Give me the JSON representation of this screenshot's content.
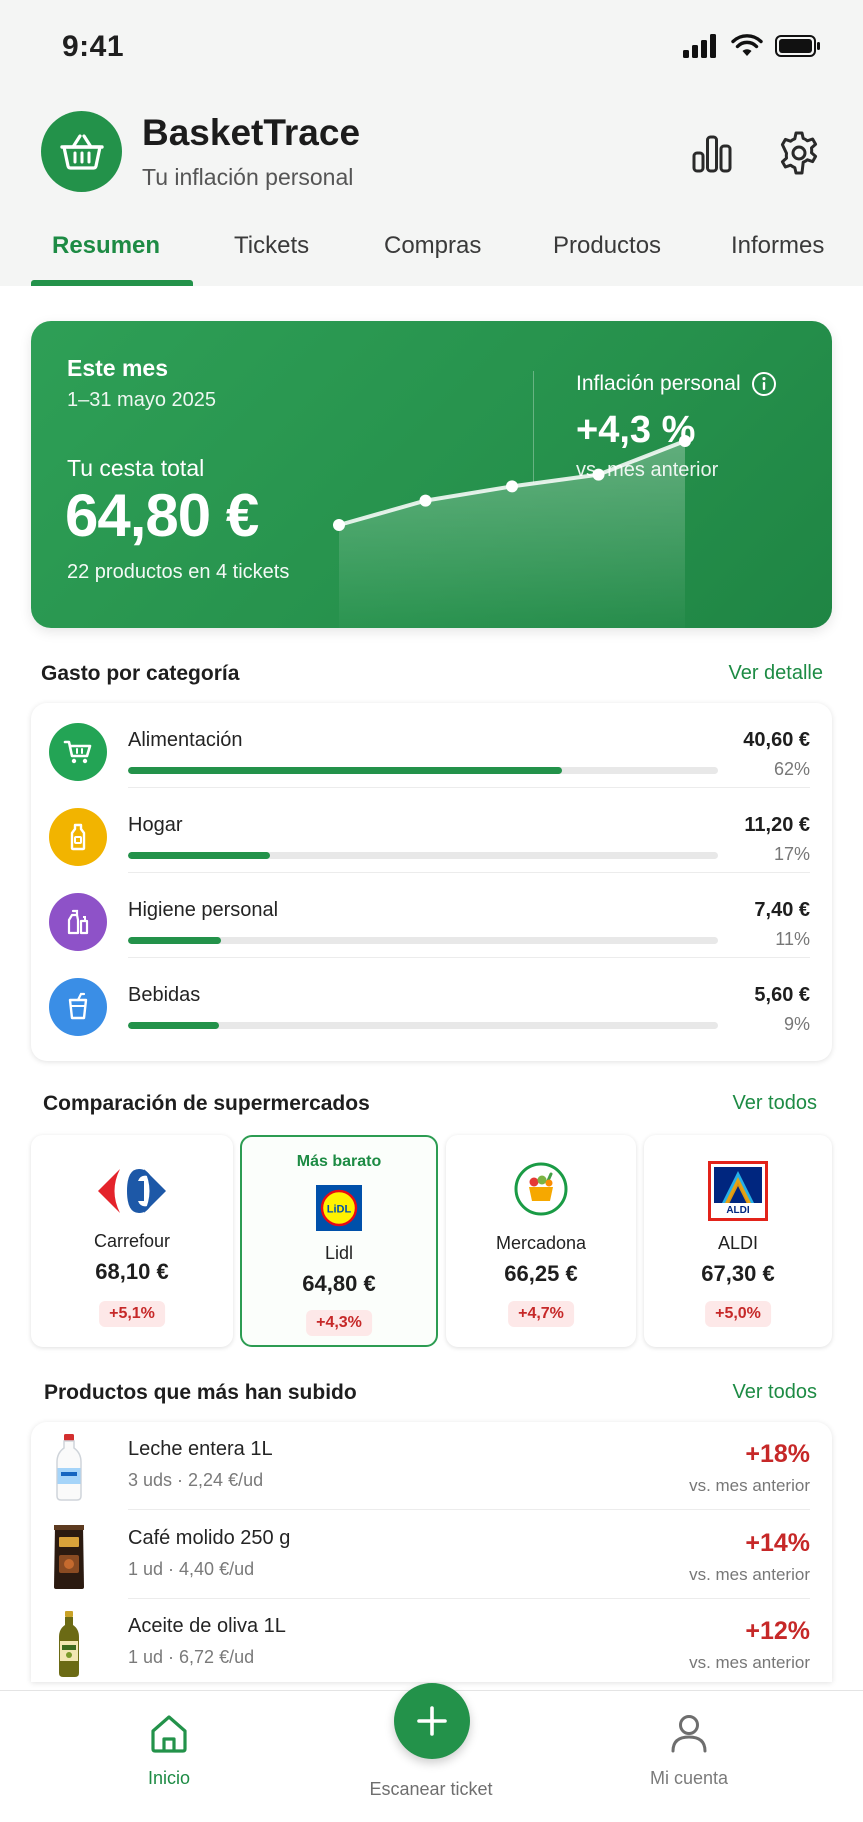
{
  "status": {
    "time": "9:41"
  },
  "app": {
    "title": "BasketTrace",
    "subtitle": "Tu inflación personal"
  },
  "tabs": [
    {
      "label": "Resumen",
      "active": true
    },
    {
      "label": "Tickets"
    },
    {
      "label": "Compras"
    },
    {
      "label": "Productos"
    },
    {
      "label": "Informes"
    }
  ],
  "hero": {
    "period_label": "Este mes",
    "period_range": "1–31 mayo 2025",
    "total_label": "Tu cesta total",
    "total": "64,80 €",
    "count": "22 productos en 4 tickets",
    "inflation_label": "Inflación personal",
    "inflation": "+4,3 %",
    "inflation_vs": "vs. mes anterior",
    "trend": [
      0,
      0.29,
      0.46,
      0.6,
      1
    ]
  },
  "categories": {
    "title": "Gasto por categoría",
    "link": "Ver detalle",
    "items": [
      {
        "name": "Alimentación",
        "amount": "40,60 €",
        "pct": "62%",
        "share": 0.735,
        "color": "#23a455",
        "icon": "cart-icon"
      },
      {
        "name": "Hogar",
        "amount": "11,20 €",
        "pct": "17%",
        "share": 0.24,
        "color": "#f2b400",
        "icon": "bottle-icon"
      },
      {
        "name": "Higiene personal",
        "amount": "7,40 €",
        "pct": "11%",
        "share": 0.158,
        "color": "#8e52c8",
        "icon": "hygiene-icon"
      },
      {
        "name": "Bebidas",
        "amount": "5,60 €",
        "pct": "9%",
        "share": 0.155,
        "color": "#3a8ee6",
        "icon": "cup-icon"
      }
    ]
  },
  "stores": {
    "title": "Comparación de supermercados",
    "link": "Ver todos",
    "best_label": "Más barato",
    "items": [
      {
        "name": "Carrefour",
        "price": "68,10 €",
        "change": "+5,1%"
      },
      {
        "name": "Lidl",
        "price": "64,80 €",
        "change": "+4,3%",
        "best": true
      },
      {
        "name": "Mercadona",
        "price": "66,25 €",
        "change": "+4,7%"
      },
      {
        "name": "ALDI",
        "price": "67,30 €",
        "change": "+5,0%"
      }
    ]
  },
  "products": {
    "title": "Productos que más han subido",
    "link": "Ver todos",
    "items": [
      {
        "name": "Leche entera 1L",
        "meta": "3 uds · 2,24 €/ud",
        "change": "+18%",
        "vs": "vs. mes anterior"
      },
      {
        "name": "Café molido 250 g",
        "meta": "1 ud · 4,40 €/ud",
        "change": "+14%",
        "vs": "vs. mes anterior"
      },
      {
        "name": "Aceite de oliva 1L",
        "meta": "1 ud · 6,72 €/ud",
        "change": "+12%",
        "vs": "vs. mes anterior"
      }
    ]
  },
  "nav": {
    "home": "Inicio",
    "scan": "Escanear ticket",
    "account": "Mi cuenta"
  },
  "logos": {
    "lidl_text": "LiDL",
    "aldi_text": "ALDI"
  }
}
